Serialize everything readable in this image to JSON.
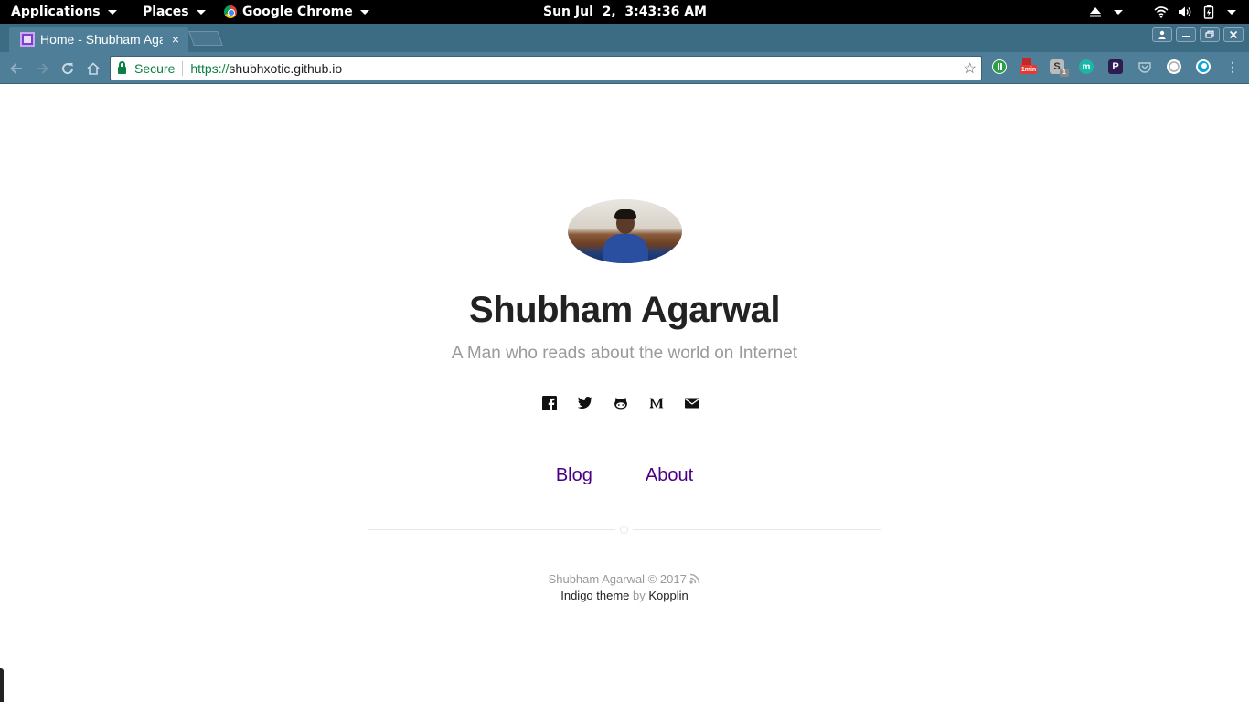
{
  "topbar": {
    "applications": "Applications",
    "places": "Places",
    "app": "Google Chrome",
    "clock": "Sun Jul  2,  3:43:36 AM"
  },
  "browser": {
    "tab_title": "Home - Shubham Agarwal",
    "tab_close": "×",
    "secure_label": "Secure",
    "url_scheme": "https://",
    "url_host": "shubhxotic.github.io",
    "ext_badge_time": "1min",
    "ext_badge_count": "1"
  },
  "profile": {
    "name": "Shubham Agarwal",
    "tagline": "A Man who reads about the world on Internet"
  },
  "nav": {
    "blog": "Blog",
    "about": "About"
  },
  "footer": {
    "copyright": "Shubham Agarwal © 2017",
    "theme": "Indigo theme",
    "by": "by",
    "author": "Kopplin"
  },
  "colors": {
    "link": "#4b0082",
    "tabstrip": "#3c6b84",
    "toolbar": "#4f7f98",
    "secure_green": "#0b8043"
  },
  "icons": [
    "facebook-icon",
    "twitter-icon",
    "github-icon",
    "medium-icon",
    "email-icon",
    "rss-icon"
  ]
}
